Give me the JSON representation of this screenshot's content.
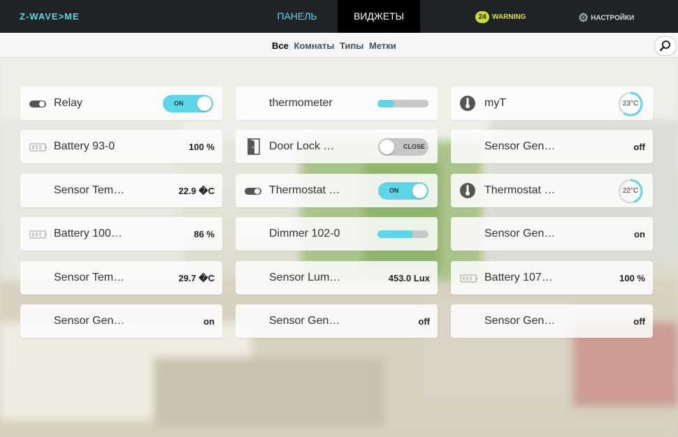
{
  "header": {
    "logo": "Z-WAVE>ME",
    "tabs": [
      {
        "label": "ПАНЕЛЬ"
      },
      {
        "label": "ВИДЖЕТЫ"
      }
    ],
    "warning": {
      "count": "24",
      "label": "WARNING"
    },
    "settings": {
      "label": "НАСТРОЙКИ"
    }
  },
  "filters": {
    "all": "Все",
    "rooms": "Комнаты",
    "types": "Типы",
    "tags": "Метки"
  },
  "colors": {
    "accent": "#5fd6e8",
    "warning": "#c9dc2d",
    "topbar": "#1e2326"
  },
  "widgets": {
    "c0": [
      {
        "name": "Relay",
        "control": "ON",
        "icon": "toggle-icon"
      },
      {
        "name": "Battery 93-0",
        "value": "100 %",
        "icon": "battery-icon"
      },
      {
        "name": "Sensor Tem…",
        "value": "22.9 �C"
      },
      {
        "name": "Battery 100…",
        "value": "86 %",
        "icon": "battery-icon"
      },
      {
        "name": "Sensor Tem…",
        "value": "29.7 �C"
      },
      {
        "name": "Sensor Gen…",
        "value": "on"
      }
    ],
    "c1": [
      {
        "name": "thermometer",
        "level": 0.33
      },
      {
        "name": "Door Lock …",
        "control": "CLOSE",
        "icon": "door-icon"
      },
      {
        "name": "Thermostat …",
        "control": "ON",
        "icon": "toggle-icon"
      },
      {
        "name": "Dimmer 102-0",
        "level": 0.7
      },
      {
        "name": "Sensor Lum…",
        "value": "453.0 Lux"
      },
      {
        "name": "Sensor Gen…",
        "value": "off"
      }
    ],
    "c2": [
      {
        "name": "myT",
        "gauge": "23°C",
        "level": 0.6,
        "icon": "thermometer-icon"
      },
      {
        "name": "Sensor Gen…",
        "value": "off"
      },
      {
        "name": "Thermostat …",
        "gauge": "22°C",
        "level": 0.45,
        "icon": "thermometer-icon"
      },
      {
        "name": "Sensor Gen…",
        "value": "on"
      },
      {
        "name": "Battery 107…",
        "value": "100 %",
        "icon": "battery-icon"
      },
      {
        "name": "Sensor Gen…",
        "value": "off"
      }
    ]
  }
}
